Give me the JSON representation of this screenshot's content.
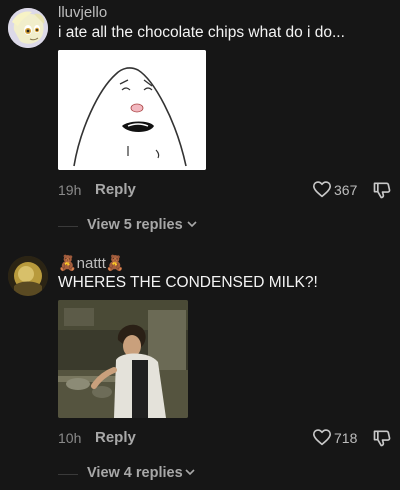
{
  "comments": [
    {
      "username": "lluvjello",
      "text": "i ate all the chocolate chips what do i do...",
      "time": "19h",
      "reply_label": "Reply",
      "like_count": "367",
      "view_replies": "View 5 replies",
      "avatar_icon": "pony-avatar",
      "image_icon": "meme-face-drawing"
    },
    {
      "username": "🧸nattt🧸",
      "text": "WHERES THE CONDENSED MILK?!",
      "time": "10h",
      "reply_label": "Reply",
      "like_count": "718",
      "view_replies": "View 4 replies",
      "avatar_icon": "photo-avatar",
      "image_icon": "kitchen-chef-photo"
    }
  ],
  "colors": {
    "background": "#161616",
    "primary_text": "#f4f4f4",
    "secondary_text": "#a8a8a8"
  }
}
